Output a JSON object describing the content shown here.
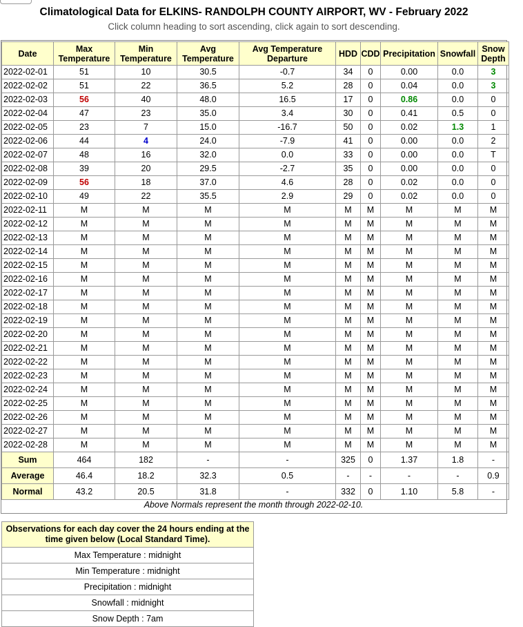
{
  "title": "Climatological Data for ELKINS- RANDOLPH COUNTY AIRPORT, WV - February 2022",
  "subtitle": "Click column heading to sort ascending, click again to sort descending.",
  "columns": [
    {
      "line1": "Date",
      "line2": ""
    },
    {
      "line1": "Max",
      "line2": "Temperature"
    },
    {
      "line1": "Min",
      "line2": "Temperature"
    },
    {
      "line1": "Avg",
      "line2": "Temperature"
    },
    {
      "line1": "Avg Temperature",
      "line2": "Departure"
    },
    {
      "line1": "HDD",
      "line2": ""
    },
    {
      "line1": "CDD",
      "line2": ""
    },
    {
      "line1": "Precipitation",
      "line2": ""
    },
    {
      "line1": "Snowfall",
      "line2": ""
    },
    {
      "line1": "Snow",
      "line2": "Depth"
    }
  ],
  "rows": [
    [
      "2022-02-01",
      "51",
      "10",
      "30.5",
      "-0.7",
      "34",
      "0",
      "0.00",
      "0.0",
      "3"
    ],
    [
      "2022-02-02",
      "51",
      "22",
      "36.5",
      "5.2",
      "28",
      "0",
      "0.04",
      "0.0",
      "3"
    ],
    [
      "2022-02-03",
      "56",
      "40",
      "48.0",
      "16.5",
      "17",
      "0",
      "0.86",
      "0.0",
      "0"
    ],
    [
      "2022-02-04",
      "47",
      "23",
      "35.0",
      "3.4",
      "30",
      "0",
      "0.41",
      "0.5",
      "0"
    ],
    [
      "2022-02-05",
      "23",
      "7",
      "15.0",
      "-16.7",
      "50",
      "0",
      "0.02",
      "1.3",
      "1"
    ],
    [
      "2022-02-06",
      "44",
      "4",
      "24.0",
      "-7.9",
      "41",
      "0",
      "0.00",
      "0.0",
      "2"
    ],
    [
      "2022-02-07",
      "48",
      "16",
      "32.0",
      "0.0",
      "33",
      "0",
      "0.00",
      "0.0",
      "T"
    ],
    [
      "2022-02-08",
      "39",
      "20",
      "29.5",
      "-2.7",
      "35",
      "0",
      "0.00",
      "0.0",
      "0"
    ],
    [
      "2022-02-09",
      "56",
      "18",
      "37.0",
      "4.6",
      "28",
      "0",
      "0.02",
      "0.0",
      "0"
    ],
    [
      "2022-02-10",
      "49",
      "22",
      "35.5",
      "2.9",
      "29",
      "0",
      "0.02",
      "0.0",
      "0"
    ],
    [
      "2022-02-11",
      "M",
      "M",
      "M",
      "M",
      "M",
      "M",
      "M",
      "M",
      "M"
    ],
    [
      "2022-02-12",
      "M",
      "M",
      "M",
      "M",
      "M",
      "M",
      "M",
      "M",
      "M"
    ],
    [
      "2022-02-13",
      "M",
      "M",
      "M",
      "M",
      "M",
      "M",
      "M",
      "M",
      "M"
    ],
    [
      "2022-02-14",
      "M",
      "M",
      "M",
      "M",
      "M",
      "M",
      "M",
      "M",
      "M"
    ],
    [
      "2022-02-15",
      "M",
      "M",
      "M",
      "M",
      "M",
      "M",
      "M",
      "M",
      "M"
    ],
    [
      "2022-02-16",
      "M",
      "M",
      "M",
      "M",
      "M",
      "M",
      "M",
      "M",
      "M"
    ],
    [
      "2022-02-17",
      "M",
      "M",
      "M",
      "M",
      "M",
      "M",
      "M",
      "M",
      "M"
    ],
    [
      "2022-02-18",
      "M",
      "M",
      "M",
      "M",
      "M",
      "M",
      "M",
      "M",
      "M"
    ],
    [
      "2022-02-19",
      "M",
      "M",
      "M",
      "M",
      "M",
      "M",
      "M",
      "M",
      "M"
    ],
    [
      "2022-02-20",
      "M",
      "M",
      "M",
      "M",
      "M",
      "M",
      "M",
      "M",
      "M"
    ],
    [
      "2022-02-21",
      "M",
      "M",
      "M",
      "M",
      "M",
      "M",
      "M",
      "M",
      "M"
    ],
    [
      "2022-02-22",
      "M",
      "M",
      "M",
      "M",
      "M",
      "M",
      "M",
      "M",
      "M"
    ],
    [
      "2022-02-23",
      "M",
      "M",
      "M",
      "M",
      "M",
      "M",
      "M",
      "M",
      "M"
    ],
    [
      "2022-02-24",
      "M",
      "M",
      "M",
      "M",
      "M",
      "M",
      "M",
      "M",
      "M"
    ],
    [
      "2022-02-25",
      "M",
      "M",
      "M",
      "M",
      "M",
      "M",
      "M",
      "M",
      "M"
    ],
    [
      "2022-02-26",
      "M",
      "M",
      "M",
      "M",
      "M",
      "M",
      "M",
      "M",
      "M"
    ],
    [
      "2022-02-27",
      "M",
      "M",
      "M",
      "M",
      "M",
      "M",
      "M",
      "M",
      "M"
    ],
    [
      "2022-02-28",
      "M",
      "M",
      "M",
      "M",
      "M",
      "M",
      "M",
      "M",
      "M"
    ]
  ],
  "highlights": {
    "red": "#c00000",
    "blue": "#0000cc",
    "green": "#008800",
    "cells": [
      {
        "row": 0,
        "col": 9,
        "color": "green"
      },
      {
        "row": 1,
        "col": 9,
        "color": "green"
      },
      {
        "row": 2,
        "col": 1,
        "color": "red"
      },
      {
        "row": 2,
        "col": 7,
        "color": "green"
      },
      {
        "row": 4,
        "col": 8,
        "color": "green"
      },
      {
        "row": 5,
        "col": 2,
        "color": "blue"
      },
      {
        "row": 8,
        "col": 1,
        "color": "red"
      }
    ]
  },
  "summary": [
    {
      "label": "Sum",
      "values": [
        "464",
        "182",
        "-",
        "-",
        "325",
        "0",
        "1.37",
        "1.8",
        "-"
      ]
    },
    {
      "label": "Average",
      "values": [
        "46.4",
        "18.2",
        "32.3",
        "0.5",
        "-",
        "-",
        "-",
        "-",
        "0.9"
      ]
    },
    {
      "label": "Normal",
      "values": [
        "43.2",
        "20.5",
        "31.8",
        "-",
        "332",
        "0",
        "1.10",
        "5.8",
        "-"
      ]
    }
  ],
  "note": "Above Normals represent the month through 2022-02-10.",
  "observations": {
    "header": "Observations for each day cover the 24 hours ending at the time given below (Local Standard Time).",
    "items": [
      "Max Temperature : midnight",
      "Min Temperature : midnight",
      "Precipitation : midnight",
      "Snowfall : midnight",
      "Snow Depth : 7am"
    ]
  },
  "header_bg": "#ffffcc"
}
